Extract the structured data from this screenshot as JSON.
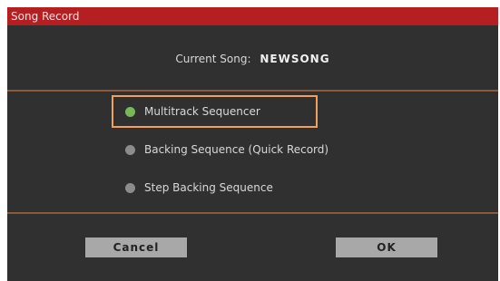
{
  "dialog": {
    "title": "Song Record",
    "current_song_label": "Current Song:",
    "current_song_name": "NEWSONG",
    "options": [
      {
        "label": "Multitrack Sequencer",
        "selected": true
      },
      {
        "label": "Backing Sequence (Quick Record)",
        "selected": false
      },
      {
        "label": "Step Backing Sequence",
        "selected": false
      }
    ],
    "cancel_label": "Cancel",
    "ok_label": "OK"
  },
  "colors": {
    "title_bar": "#b51f22",
    "background": "#303030",
    "highlight": "#f0a05a",
    "radio_selected": "#79b85a",
    "radio_unselected": "#8c8c8c",
    "button": "#a8a8a8"
  }
}
